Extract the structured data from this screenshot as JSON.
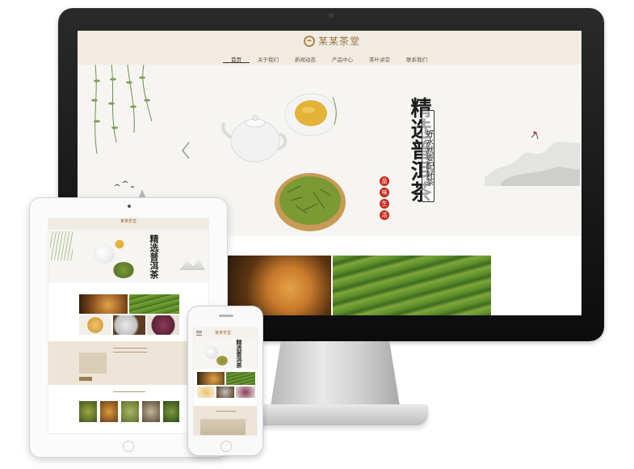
{
  "site": {
    "logo_text": "某某茶堂",
    "nav": [
      "首页",
      "关于我们",
      "新闻动态",
      "产品中心",
      "茶叶讲堂",
      "联系我们"
    ],
    "active_nav": "首页"
  },
  "hero": {
    "headline": "精选普洱茶",
    "tagline": "好水就要配好茶",
    "seals": [
      "品",
      "味",
      "生",
      "活"
    ]
  },
  "tablet": {
    "logo_text": "某某茶堂",
    "headline": "精选普洱茶"
  },
  "phone": {
    "logo_text": "某某茶堂",
    "headline": "精选普洱茶"
  },
  "colors": {
    "header_bg": "#f1ece3",
    "brand_gold": "#9a7440",
    "seal_red": "#c9291e",
    "band_beige": "#ede5d7"
  },
  "icons": [
    "logo-icon",
    "prev-arrow-icon",
    "menu-icon",
    "camera-icon",
    "home-button-icon"
  ]
}
